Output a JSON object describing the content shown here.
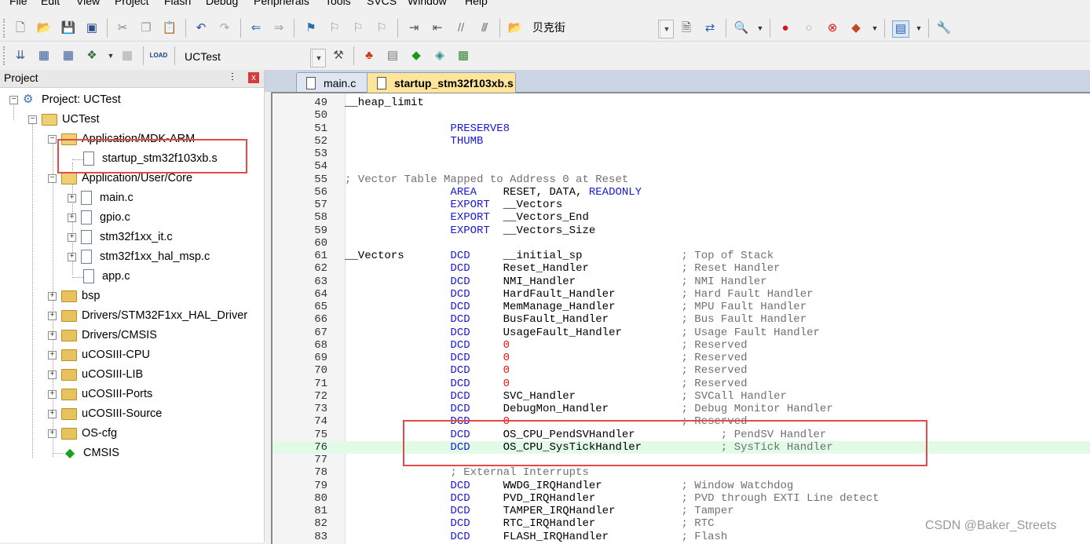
{
  "menu": [
    "File",
    "Edit",
    "View",
    "Project",
    "Flash",
    "Debug",
    "Peripherals",
    "Tools",
    "SVCS",
    "Window",
    "Help"
  ],
  "toolbar": {
    "find_text": "贝克街",
    "target_name": "UCTest"
  },
  "project_panel": {
    "title": "Project",
    "pin_glyph": "ⵗ",
    "close_glyph": "x",
    "tree": [
      {
        "label": "Project: UCTest",
        "icon": "project-icon"
      },
      {
        "label": "UCTest",
        "icon": "folder-icon"
      },
      {
        "label": "Application/MDK-ARM",
        "icon": "folder-icon"
      },
      {
        "label": "startup_stm32f103xb.s",
        "icon": "file-icon"
      },
      {
        "label": "Application/User/Core",
        "icon": "folder-icon"
      },
      {
        "label": "main.c",
        "icon": "file-icon"
      },
      {
        "label": "gpio.c",
        "icon": "file-icon"
      },
      {
        "label": "stm32f1xx_it.c",
        "icon": "file-icon"
      },
      {
        "label": "stm32f1xx_hal_msp.c",
        "icon": "file-icon"
      },
      {
        "label": "app.c",
        "icon": "file-icon"
      },
      {
        "label": "bsp",
        "icon": "folder-icon"
      },
      {
        "label": "Drivers/STM32F1xx_HAL_Driver",
        "icon": "folder-icon"
      },
      {
        "label": "Drivers/CMSIS",
        "icon": "folder-icon"
      },
      {
        "label": "uCOSIII-CPU",
        "icon": "folder-icon"
      },
      {
        "label": "uCOSIII-LIB",
        "icon": "folder-icon"
      },
      {
        "label": "uCOSIII-Ports",
        "icon": "folder-icon"
      },
      {
        "label": "uCOSIII-Source",
        "icon": "folder-icon"
      },
      {
        "label": "OS-cfg",
        "icon": "folder-icon"
      },
      {
        "label": "CMSIS",
        "icon": "gem-icon"
      }
    ]
  },
  "tabs": [
    {
      "label": "main.c",
      "active": false
    },
    {
      "label": "startup_stm32f103xb.s",
      "active": true
    }
  ],
  "code": [
    {
      "n": "49",
      "t": "__heap_limit"
    },
    {
      "n": "50",
      "t": ""
    },
    {
      "n": "51",
      "t": "                PRESERVE8"
    },
    {
      "n": "52",
      "t": "                THUMB"
    },
    {
      "n": "53",
      "t": ""
    },
    {
      "n": "54",
      "t": ""
    },
    {
      "n": "55",
      "t": "; Vector Table Mapped to Address 0 at Reset"
    },
    {
      "n": "56",
      "t": "                AREA    RESET, DATA, READONLY"
    },
    {
      "n": "57",
      "t": "                EXPORT  __Vectors"
    },
    {
      "n": "58",
      "t": "                EXPORT  __Vectors_End"
    },
    {
      "n": "59",
      "t": "                EXPORT  __Vectors_Size"
    },
    {
      "n": "60",
      "t": ""
    },
    {
      "n": "61",
      "t": "__Vectors       DCD     __initial_sp               ; Top of Stack"
    },
    {
      "n": "62",
      "t": "                DCD     Reset_Handler              ; Reset Handler"
    },
    {
      "n": "63",
      "t": "                DCD     NMI_Handler                ; NMI Handler"
    },
    {
      "n": "64",
      "t": "                DCD     HardFault_Handler          ; Hard Fault Handler"
    },
    {
      "n": "65",
      "t": "                DCD     MemManage_Handler          ; MPU Fault Handler"
    },
    {
      "n": "66",
      "t": "                DCD     BusFault_Handler           ; Bus Fault Handler"
    },
    {
      "n": "67",
      "t": "                DCD     UsageFault_Handler         ; Usage Fault Handler"
    },
    {
      "n": "68",
      "t": "                DCD     0                          ; Reserved"
    },
    {
      "n": "69",
      "t": "                DCD     0                          ; Reserved"
    },
    {
      "n": "70",
      "t": "                DCD     0                          ; Reserved"
    },
    {
      "n": "71",
      "t": "                DCD     0                          ; Reserved"
    },
    {
      "n": "72",
      "t": "                DCD     SVC_Handler                ; SVCall Handler"
    },
    {
      "n": "73",
      "t": "                DCD     DebugMon_Handler           ; Debug Monitor Handler"
    },
    {
      "n": "74",
      "t": "                DCD     0                          ; Reserved"
    },
    {
      "n": "75",
      "t": "                DCD     OS_CPU_PendSVHandler             ; PendSV Handler"
    },
    {
      "n": "76",
      "t": "                DCD     OS_CPU_SysTickHandler            ; SysTick Handler"
    },
    {
      "n": "77",
      "t": ""
    },
    {
      "n": "78",
      "t": "                ; External Interrupts"
    },
    {
      "n": "79",
      "t": "                DCD     WWDG_IRQHandler            ; Window Watchdog"
    },
    {
      "n": "80",
      "t": "                DCD     PVD_IRQHandler             ; PVD through EXTI Line detect"
    },
    {
      "n": "81",
      "t": "                DCD     TAMPER_IRQHandler          ; Tamper"
    },
    {
      "n": "82",
      "t": "                DCD     RTC_IRQHandler             ; RTC"
    },
    {
      "n": "83",
      "t": "                DCD     FLASH_IRQHandler           ; Flash"
    }
  ],
  "highlight_line": "76",
  "watermark": "CSDN @Baker_Streets",
  "colors": {
    "keyword": "#1818d8",
    "comment": "#707070",
    "number": "#ee1010",
    "annotation_box": "#e34a4a",
    "current_line": "#e2fbe6"
  }
}
